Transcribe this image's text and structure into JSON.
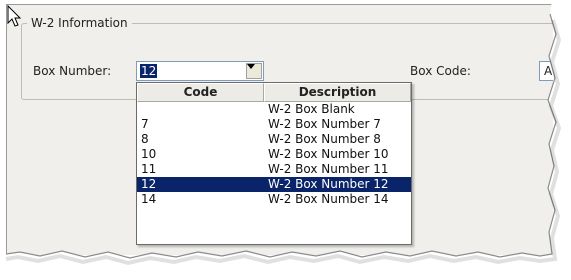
{
  "group": {
    "title": "W-2 Information"
  },
  "box_number": {
    "label": "Box Number:",
    "value": "12"
  },
  "box_code": {
    "label": "Box Code:",
    "value": "A"
  },
  "dropdown": {
    "headers": {
      "code": "Code",
      "description": "Description"
    },
    "rows": [
      {
        "code": "",
        "description": "W-2 Box Blank"
      },
      {
        "code": "7",
        "description": "W-2 Box Number 7"
      },
      {
        "code": "8",
        "description": "W-2 Box Number 8"
      },
      {
        "code": "10",
        "description": "W-2 Box Number 10"
      },
      {
        "code": "11",
        "description": "W-2 Box Number 11"
      },
      {
        "code": "12",
        "description": "W-2 Box Number 12"
      },
      {
        "code": "14",
        "description": "W-2 Box Number 14"
      }
    ],
    "selected_code": "12"
  },
  "colors": {
    "selection": "#0a246a",
    "window_bg": "#f0efeb",
    "edge": "#9a9a9a"
  }
}
